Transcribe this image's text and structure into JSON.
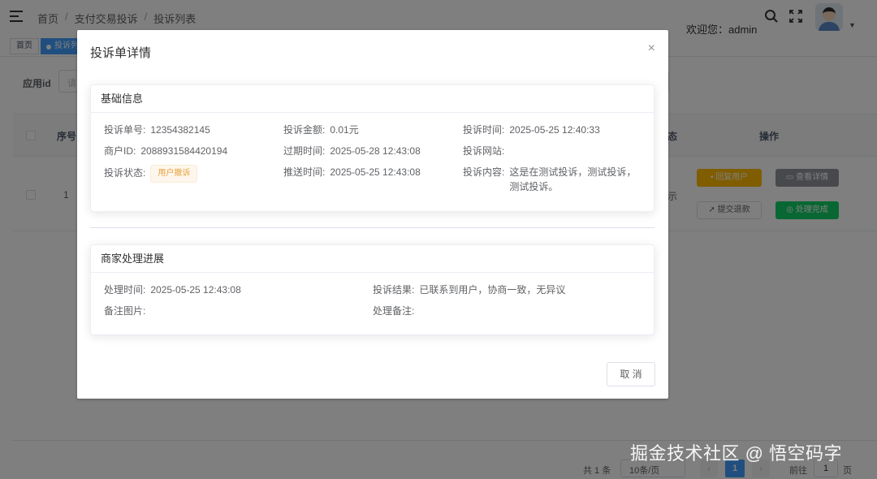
{
  "header": {
    "breadcrumb": [
      "首页",
      "支付交易投诉",
      "投诉列表"
    ],
    "breadcrumb_sep": "/",
    "welcome": "欢迎您：admin"
  },
  "tags": {
    "home": "首页",
    "active": "投诉列"
  },
  "filter": {
    "label": "应用id",
    "placeholder": "请"
  },
  "table": {
    "headers": {
      "index": "序号",
      "status": "态",
      "actions": "操作"
    },
    "row": {
      "index": "1",
      "status_partial": "示"
    },
    "actions": {
      "reply": "回复用户",
      "view": "查看详情",
      "refund": "提交退款",
      "done": "处理完成"
    }
  },
  "pagination": {
    "total": "共 1 条",
    "page_size": "10条/页",
    "current": "1",
    "goto_label": "前往",
    "goto_value": "1",
    "page_suffix": "页"
  },
  "dialog": {
    "title": "投诉单详情",
    "close": "×",
    "basic": {
      "title": "基础信息",
      "complaint_no_label": "投诉单号:",
      "complaint_no": "12354382145",
      "amount_label": "投诉金额:",
      "amount": "0.01元",
      "time_label": "投诉时间:",
      "time": "2025-05-25 12:40:33",
      "merchant_label": "商户ID:",
      "merchant": "2088931584420194",
      "expire_label": "过期时间:",
      "expire": "2025-05-28 12:43:08",
      "site_label": "投诉网站:",
      "site": "",
      "status_label": "投诉状态:",
      "status": "用户撤诉",
      "push_label": "推送时间:",
      "push": "2025-05-25 12:43:08",
      "content_label": "投诉内容:",
      "content": "这是在测试投诉，测试投诉，测试投诉。"
    },
    "progress": {
      "title": "商家处理进展",
      "handle_time_label": "处理时间:",
      "handle_time": "2025-05-25 12:43:08",
      "result_label": "投诉结果:",
      "result": "已联系到用户，协商一致，无异议",
      "image_label": "备注图片:",
      "note_label": "处理备注:"
    },
    "cancel": "取 消"
  },
  "watermark": "掘金技术社区 @ 悟空码字"
}
